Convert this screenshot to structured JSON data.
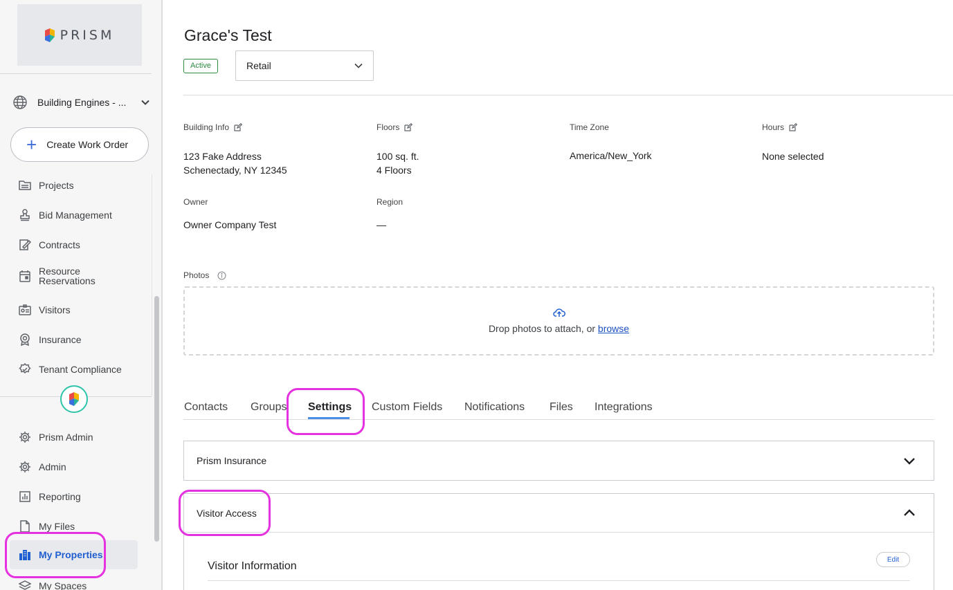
{
  "sidebar": {
    "logo_text": "PRISM",
    "org_name": "Building Engines - ...",
    "create_label": "Create Work Order",
    "items": [
      {
        "label": "Projects",
        "icon": "folder-icon"
      },
      {
        "label": "Bid Management",
        "icon": "stamp-icon"
      },
      {
        "label": "Contracts",
        "icon": "contract-icon"
      },
      {
        "label": "Resource Reservations",
        "icon": "calendar-icon"
      },
      {
        "label": "Visitors",
        "icon": "badge-icon"
      },
      {
        "label": "Insurance",
        "icon": "award-icon"
      },
      {
        "label": "Tenant Compliance",
        "icon": "check-badge-icon"
      }
    ],
    "admin_items": [
      {
        "label": "Prism Admin",
        "icon": "gear-icon"
      },
      {
        "label": "Admin",
        "icon": "gear-icon"
      },
      {
        "label": "Reporting",
        "icon": "bar-chart-icon"
      },
      {
        "label": "My Files",
        "icon": "file-icon"
      },
      {
        "label": "My Properties",
        "icon": "building-icon"
      },
      {
        "label": "My Spaces",
        "icon": "layers-icon"
      }
    ]
  },
  "property": {
    "title": "Grace's Test",
    "status": "Active",
    "type": "Retail"
  },
  "info": {
    "building_info_label": "Building Info",
    "address_line1": "123 Fake Address",
    "address_line2": "Schenectady, NY 12345",
    "floors_label": "Floors",
    "floors_area": "100 sq. ft.",
    "floors_count": "4 Floors",
    "timezone_label": "Time Zone",
    "timezone_value": "America/New_York",
    "hours_label": "Hours",
    "hours_value": "None selected",
    "owner_label": "Owner",
    "owner_value": "Owner Company Test",
    "region_label": "Region",
    "region_value": "—"
  },
  "photos": {
    "label": "Photos",
    "drop_text": "Drop photos to attach, or ",
    "browse_label": "browse"
  },
  "tabs": [
    "Contacts",
    "Groups",
    "Settings",
    "Custom Fields",
    "Notifications",
    "Files",
    "Integrations"
  ],
  "active_tab": "Settings",
  "panels": {
    "insurance_title": "Prism Insurance",
    "visitor_title": "Visitor Access",
    "visitor_info_title": "Visitor Information",
    "edit_label": "Edit"
  },
  "colors": {
    "accent": "#1f5fd1",
    "status_green": "#2c8a3e",
    "highlight": "#e531e0"
  }
}
